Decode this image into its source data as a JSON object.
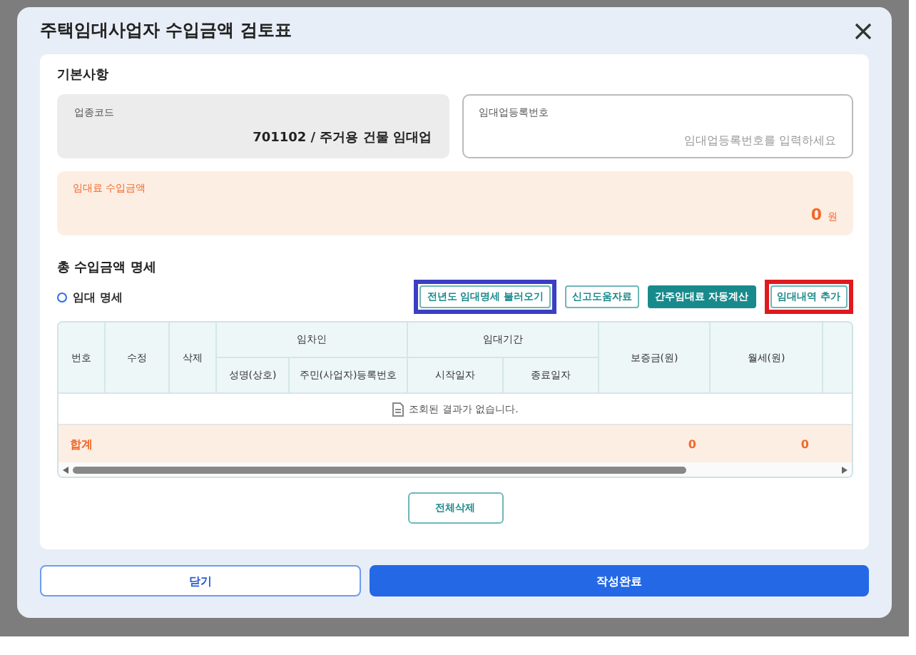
{
  "dialog": {
    "title": "주택임대사업자 수입금액 검토표"
  },
  "basic": {
    "heading": "기본사항",
    "fields": [
      {
        "label": "업종코드",
        "value": "701102 / 주거용 건물 임대업",
        "disabled": true
      },
      {
        "label": "임대업등록번호",
        "placeholder": "임대업등록번호를 입력하세요",
        "disabled": false
      }
    ],
    "income": {
      "label": "임대료 수입금액",
      "amount": "0",
      "unit": "원"
    }
  },
  "details": {
    "heading": "총 수입금액 명세",
    "subheading": "임대 명세",
    "buttons": [
      {
        "label": "전년도 임대명세 불러오기",
        "kind": "outline",
        "color": "#3b3fc4"
      },
      {
        "label": "신고도움자료",
        "kind": "outline"
      },
      {
        "label": "간주임대료 자동계산",
        "kind": "filled"
      },
      {
        "label": "임대내역 추가",
        "kind": "outline",
        "color": "#e0191f"
      }
    ],
    "table": {
      "columns": [
        {
          "label": "번호"
        },
        {
          "label": "수정"
        },
        {
          "label": "삭제"
        },
        {
          "label": "임차인",
          "children": [
            {
              "label": "성명(상호)"
            },
            {
              "label": "주민(사업자)등록번호"
            }
          ]
        },
        {
          "label": "임대기간",
          "children": [
            {
              "label": "시작일자"
            },
            {
              "label": "종료일자"
            }
          ]
        },
        {
          "label": "보증금(원)"
        },
        {
          "label": "월세(원)"
        }
      ],
      "empty_message": "조회된 결과가 없습니다.",
      "total": {
        "label": "합계",
        "deposit": "0",
        "monthly": "0"
      }
    },
    "delete_all": "전체삭제"
  },
  "footer": {
    "buttons": [
      {
        "label": "닫기",
        "kind": "secondary"
      },
      {
        "label": "작성완료",
        "kind": "primary"
      }
    ]
  }
}
